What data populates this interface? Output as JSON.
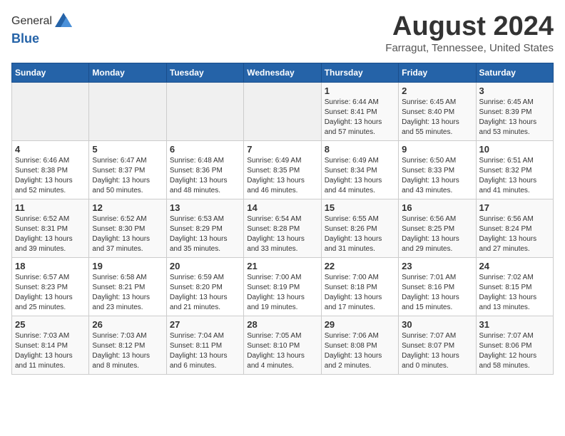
{
  "logo": {
    "general": "General",
    "blue": "Blue"
  },
  "header": {
    "month": "August 2024",
    "location": "Farragut, Tennessee, United States"
  },
  "weekdays": [
    "Sunday",
    "Monday",
    "Tuesday",
    "Wednesday",
    "Thursday",
    "Friday",
    "Saturday"
  ],
  "weeks": [
    [
      {
        "day": "",
        "info": ""
      },
      {
        "day": "",
        "info": ""
      },
      {
        "day": "",
        "info": ""
      },
      {
        "day": "",
        "info": ""
      },
      {
        "day": "1",
        "info": "Sunrise: 6:44 AM\nSunset: 8:41 PM\nDaylight: 13 hours\nand 57 minutes."
      },
      {
        "day": "2",
        "info": "Sunrise: 6:45 AM\nSunset: 8:40 PM\nDaylight: 13 hours\nand 55 minutes."
      },
      {
        "day": "3",
        "info": "Sunrise: 6:45 AM\nSunset: 8:39 PM\nDaylight: 13 hours\nand 53 minutes."
      }
    ],
    [
      {
        "day": "4",
        "info": "Sunrise: 6:46 AM\nSunset: 8:38 PM\nDaylight: 13 hours\nand 52 minutes."
      },
      {
        "day": "5",
        "info": "Sunrise: 6:47 AM\nSunset: 8:37 PM\nDaylight: 13 hours\nand 50 minutes."
      },
      {
        "day": "6",
        "info": "Sunrise: 6:48 AM\nSunset: 8:36 PM\nDaylight: 13 hours\nand 48 minutes."
      },
      {
        "day": "7",
        "info": "Sunrise: 6:49 AM\nSunset: 8:35 PM\nDaylight: 13 hours\nand 46 minutes."
      },
      {
        "day": "8",
        "info": "Sunrise: 6:49 AM\nSunset: 8:34 PM\nDaylight: 13 hours\nand 44 minutes."
      },
      {
        "day": "9",
        "info": "Sunrise: 6:50 AM\nSunset: 8:33 PM\nDaylight: 13 hours\nand 43 minutes."
      },
      {
        "day": "10",
        "info": "Sunrise: 6:51 AM\nSunset: 8:32 PM\nDaylight: 13 hours\nand 41 minutes."
      }
    ],
    [
      {
        "day": "11",
        "info": "Sunrise: 6:52 AM\nSunset: 8:31 PM\nDaylight: 13 hours\nand 39 minutes."
      },
      {
        "day": "12",
        "info": "Sunrise: 6:52 AM\nSunset: 8:30 PM\nDaylight: 13 hours\nand 37 minutes."
      },
      {
        "day": "13",
        "info": "Sunrise: 6:53 AM\nSunset: 8:29 PM\nDaylight: 13 hours\nand 35 minutes."
      },
      {
        "day": "14",
        "info": "Sunrise: 6:54 AM\nSunset: 8:28 PM\nDaylight: 13 hours\nand 33 minutes."
      },
      {
        "day": "15",
        "info": "Sunrise: 6:55 AM\nSunset: 8:26 PM\nDaylight: 13 hours\nand 31 minutes."
      },
      {
        "day": "16",
        "info": "Sunrise: 6:56 AM\nSunset: 8:25 PM\nDaylight: 13 hours\nand 29 minutes."
      },
      {
        "day": "17",
        "info": "Sunrise: 6:56 AM\nSunset: 8:24 PM\nDaylight: 13 hours\nand 27 minutes."
      }
    ],
    [
      {
        "day": "18",
        "info": "Sunrise: 6:57 AM\nSunset: 8:23 PM\nDaylight: 13 hours\nand 25 minutes."
      },
      {
        "day": "19",
        "info": "Sunrise: 6:58 AM\nSunset: 8:21 PM\nDaylight: 13 hours\nand 23 minutes."
      },
      {
        "day": "20",
        "info": "Sunrise: 6:59 AM\nSunset: 8:20 PM\nDaylight: 13 hours\nand 21 minutes."
      },
      {
        "day": "21",
        "info": "Sunrise: 7:00 AM\nSunset: 8:19 PM\nDaylight: 13 hours\nand 19 minutes."
      },
      {
        "day": "22",
        "info": "Sunrise: 7:00 AM\nSunset: 8:18 PM\nDaylight: 13 hours\nand 17 minutes."
      },
      {
        "day": "23",
        "info": "Sunrise: 7:01 AM\nSunset: 8:16 PM\nDaylight: 13 hours\nand 15 minutes."
      },
      {
        "day": "24",
        "info": "Sunrise: 7:02 AM\nSunset: 8:15 PM\nDaylight: 13 hours\nand 13 minutes."
      }
    ],
    [
      {
        "day": "25",
        "info": "Sunrise: 7:03 AM\nSunset: 8:14 PM\nDaylight: 13 hours\nand 11 minutes."
      },
      {
        "day": "26",
        "info": "Sunrise: 7:03 AM\nSunset: 8:12 PM\nDaylight: 13 hours\nand 8 minutes."
      },
      {
        "day": "27",
        "info": "Sunrise: 7:04 AM\nSunset: 8:11 PM\nDaylight: 13 hours\nand 6 minutes."
      },
      {
        "day": "28",
        "info": "Sunrise: 7:05 AM\nSunset: 8:10 PM\nDaylight: 13 hours\nand 4 minutes."
      },
      {
        "day": "29",
        "info": "Sunrise: 7:06 AM\nSunset: 8:08 PM\nDaylight: 13 hours\nand 2 minutes."
      },
      {
        "day": "30",
        "info": "Sunrise: 7:07 AM\nSunset: 8:07 PM\nDaylight: 13 hours\nand 0 minutes."
      },
      {
        "day": "31",
        "info": "Sunrise: 7:07 AM\nSunset: 8:06 PM\nDaylight: 12 hours\nand 58 minutes."
      }
    ]
  ]
}
